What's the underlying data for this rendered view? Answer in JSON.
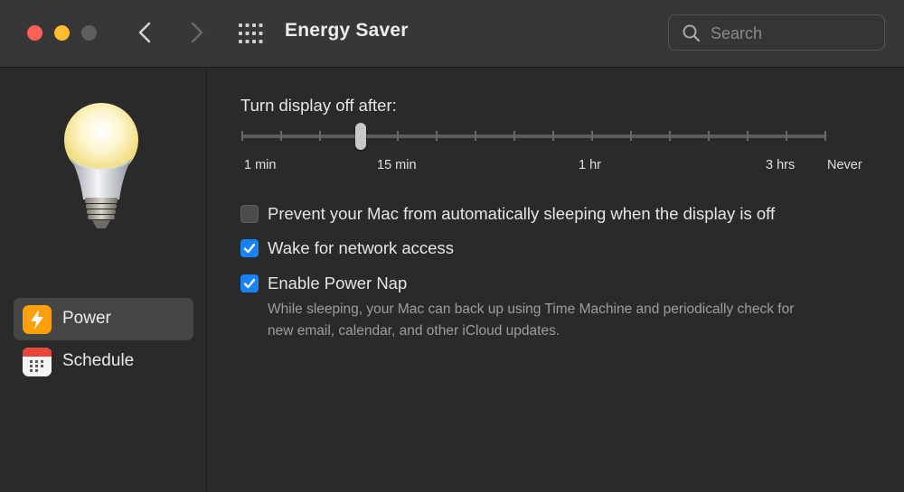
{
  "window": {
    "title": "Energy Saver",
    "traffic_lights": [
      "close",
      "minimize",
      "zoom-disabled"
    ]
  },
  "toolbar": {
    "back_icon": "chevron-left-icon",
    "forward_icon": "chevron-right-icon",
    "show_all_icon": "grid-icon"
  },
  "search": {
    "placeholder": "Search",
    "value": ""
  },
  "sidebar": {
    "items": [
      {
        "label": "Power",
        "icon": "lightning-bolt-icon",
        "selected": true
      },
      {
        "label": "Schedule",
        "icon": "calendar-icon",
        "selected": false
      }
    ]
  },
  "display_sleep": {
    "label": "Turn display off after:",
    "tick_labels": [
      "1 min",
      "15 min",
      "1 hr",
      "3 hrs",
      "Never"
    ],
    "selected": "15 min",
    "tick_count": 16
  },
  "options": [
    {
      "label": "Prevent your Mac from automatically sleeping when the display is off",
      "checked": false
    },
    {
      "label": "Wake for network access",
      "checked": true
    },
    {
      "label": "Enable Power Nap",
      "checked": true
    }
  ],
  "power_nap_description": {
    "line1": "While sleeping, your Mac can back up using Time Machine and periodically check for",
    "line2": "new email, calendar, and other iCloud updates."
  },
  "colors": {
    "accent": "#1a82f8",
    "power_icon": "#ff9f0a",
    "close": "#fe5f57",
    "minimize": "#febc2e"
  }
}
